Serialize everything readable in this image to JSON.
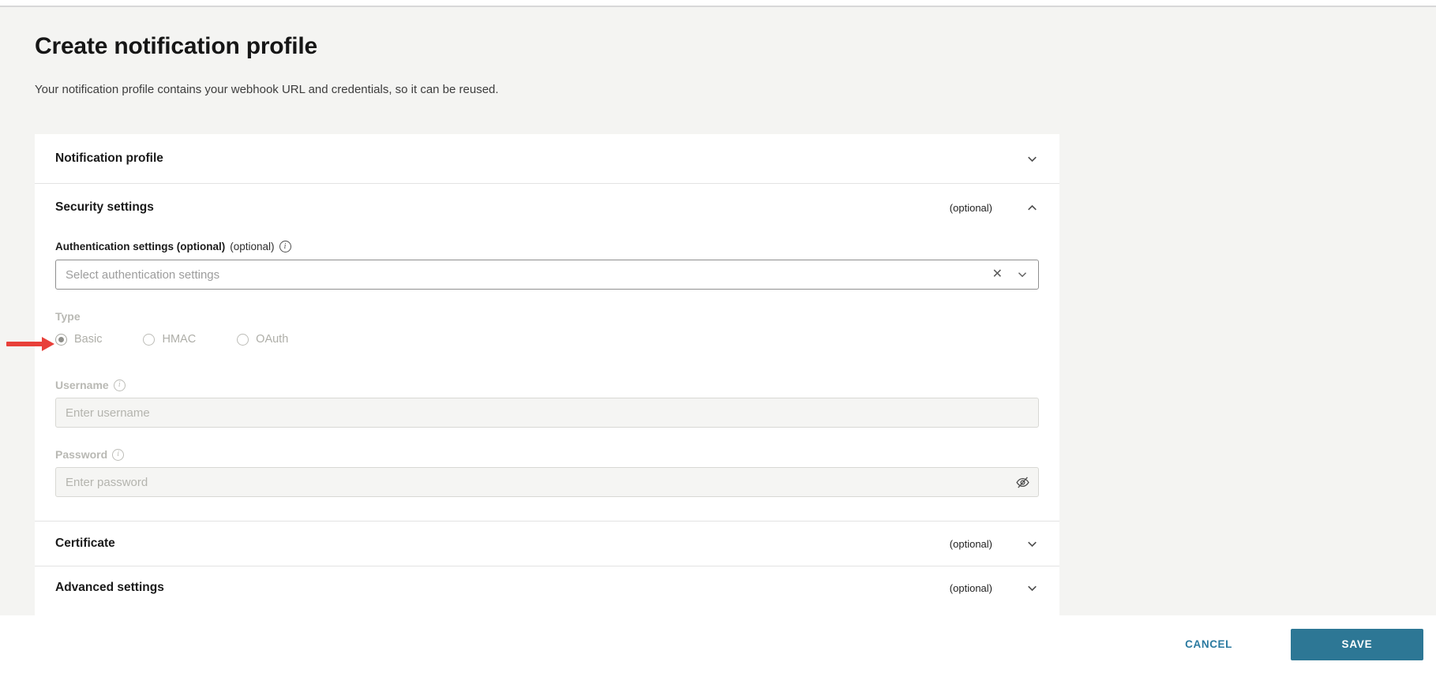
{
  "header": {
    "title": "Create notification profile",
    "subtitle": "Your notification profile contains your webhook URL and credentials, so it can be reused."
  },
  "sections": {
    "notification_profile": {
      "title": "Notification profile"
    },
    "security": {
      "title": "Security settings",
      "optional": "(optional)",
      "auth": {
        "label": "Authentication settings (optional)",
        "suffix": "(optional)",
        "placeholder": "Select authentication settings",
        "clear_icon": "✕"
      },
      "type": {
        "label": "Type",
        "options": [
          {
            "label": "Basic",
            "selected": true
          },
          {
            "label": "HMAC",
            "selected": false
          },
          {
            "label": "OAuth",
            "selected": false
          }
        ]
      },
      "username": {
        "label": "Username",
        "placeholder": "Enter username"
      },
      "password": {
        "label": "Password",
        "placeholder": "Enter password"
      },
      "info_icon_glyph": "i"
    },
    "certificate": {
      "title": "Certificate",
      "optional": "(optional)"
    },
    "advanced": {
      "title": "Advanced settings",
      "optional": "(optional)"
    }
  },
  "footer": {
    "cancel": "CANCEL",
    "save": "SAVE"
  },
  "colors": {
    "accent_teal": "#2d7795",
    "arrow_red": "#e8403a",
    "page_bg": "#f4f4f2"
  }
}
